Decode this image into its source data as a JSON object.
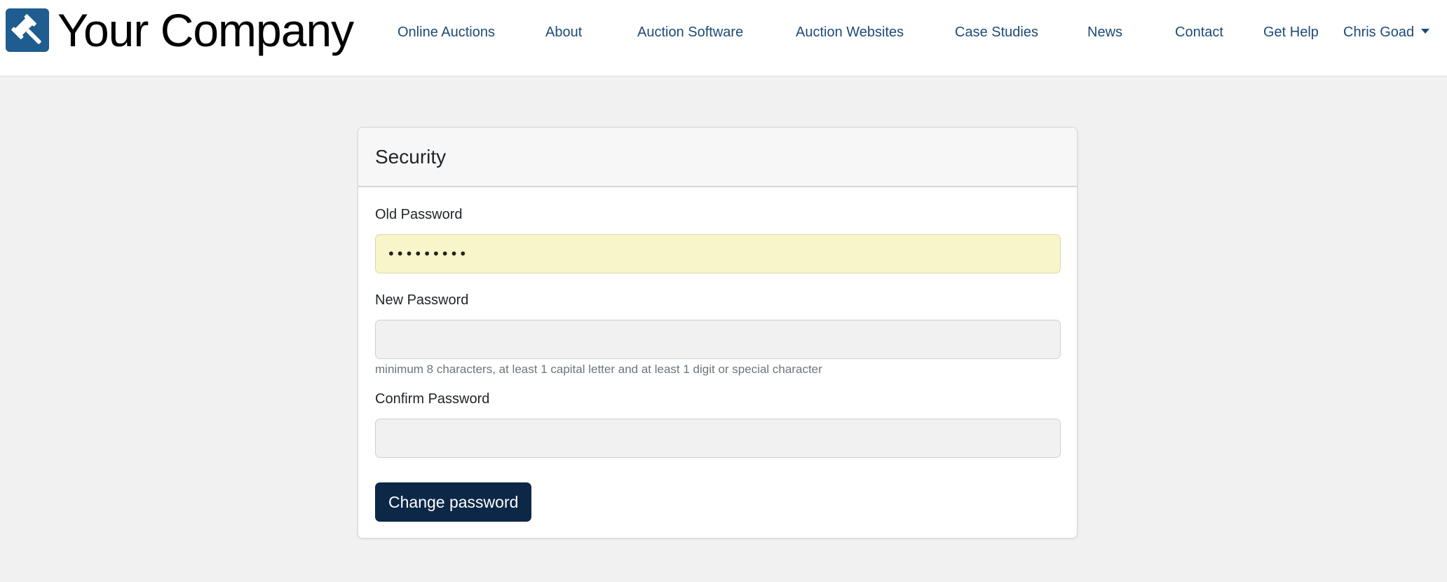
{
  "brand": {
    "name": "Your Company",
    "logo_icon": "gavel-icon",
    "logo_color": "#1f5c8f"
  },
  "nav": {
    "items": [
      {
        "label": "Online Auctions"
      },
      {
        "label": "About"
      },
      {
        "label": "Auction Software"
      },
      {
        "label": "Auction Websites"
      },
      {
        "label": "Case Studies"
      },
      {
        "label": "News"
      },
      {
        "label": "Contact"
      },
      {
        "label": "Get Help"
      }
    ],
    "user": {
      "label": "Chris Goad",
      "icon": "chevron-down-icon"
    },
    "link_color": "#1d4a78"
  },
  "security": {
    "title": "Security",
    "old_password": {
      "label": "Old Password",
      "value": "•••••••••"
    },
    "new_password": {
      "label": "New Password",
      "value": "",
      "hint": "minimum 8 characters, at least 1 capital letter and at least 1 digit or special character"
    },
    "confirm_password": {
      "label": "Confirm Password",
      "value": ""
    },
    "submit_label": "Change password",
    "button_color": "#0d2747",
    "autofill_color": "#f8f5c8"
  }
}
